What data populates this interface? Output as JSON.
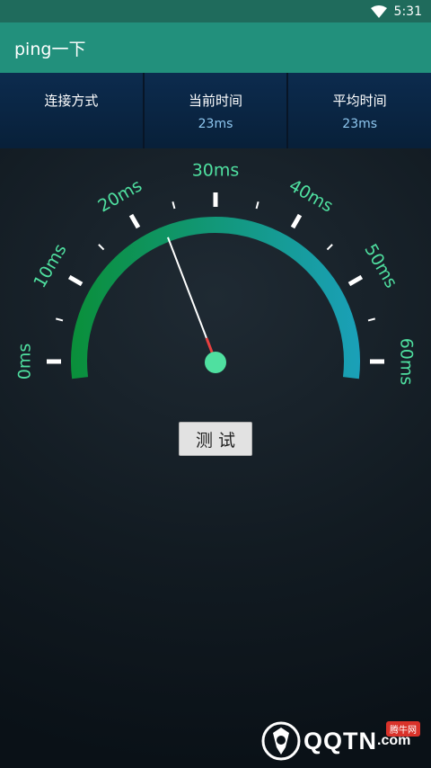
{
  "status_bar": {
    "time": "5:31",
    "wifi_icon": "wifi-icon"
  },
  "app_bar": {
    "title": "ping一下"
  },
  "stats": [
    {
      "label": "连接方式",
      "value": ""
    },
    {
      "label": "当前时间",
      "value": "23ms"
    },
    {
      "label": "平均时间",
      "value": "23ms"
    }
  ],
  "gauge": {
    "min": 0,
    "max": 60,
    "current_value_ms": 23,
    "tick_labels": [
      "0ms",
      "10ms",
      "20ms",
      "30ms",
      "40ms",
      "50ms",
      "60ms"
    ],
    "arc_colors": [
      "#0a8f3a",
      "#1aa0b8"
    ],
    "needle_color": "#ffffff",
    "needle_tip_color": "#e84040",
    "hub_color": "#4fe0a0",
    "label_color": "#4fe0a0"
  },
  "actions": {
    "test_label": "测试"
  },
  "watermark": {
    "text": "QQTN",
    "suffix": ".com",
    "badge": "腾牛网"
  }
}
